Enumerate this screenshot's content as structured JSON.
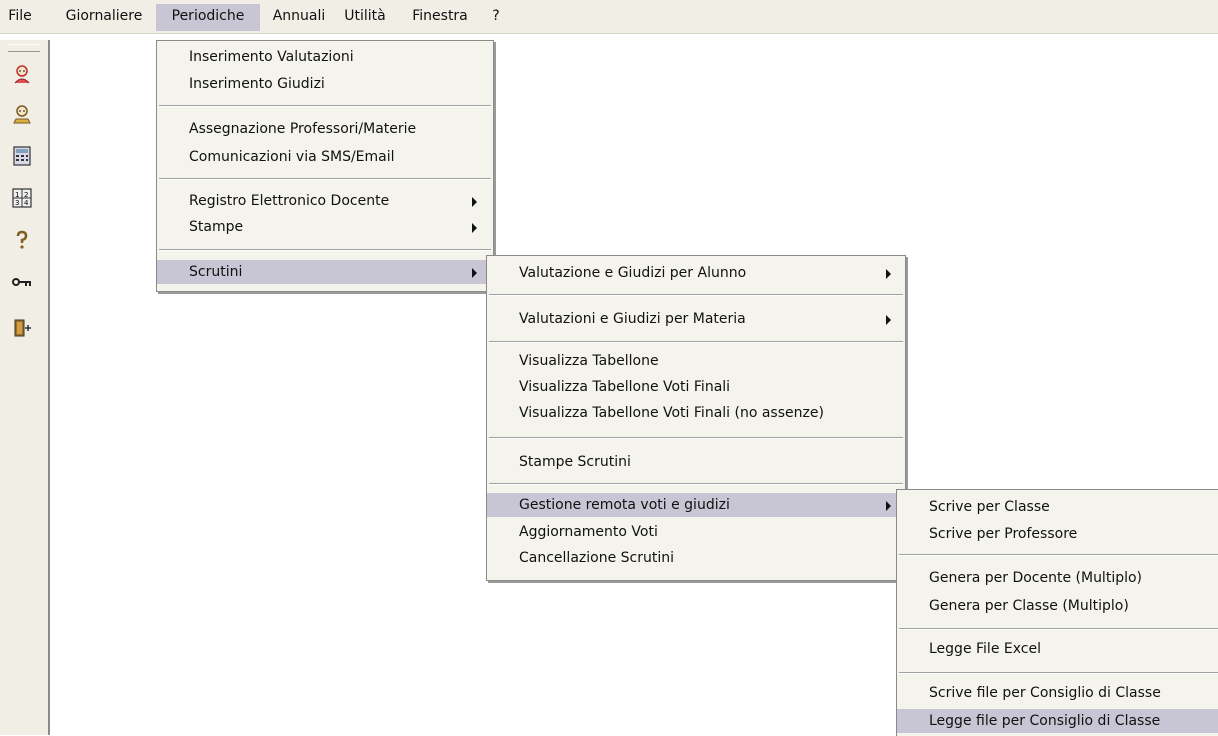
{
  "menubar": {
    "items": [
      "File",
      "Giornaliere",
      "Periodiche",
      "Annuali",
      "Utilità",
      "Finestra",
      "?"
    ],
    "active": "Periodiche"
  },
  "toolbar": {
    "icons": [
      "person-red-icon",
      "person-icon",
      "calculator-icon",
      "grid-numbers-icon",
      "help-icon",
      "key-icon",
      "exit-door-icon"
    ]
  },
  "menu_periodiche": {
    "items": [
      "Inserimento Valutazioni",
      "Inserimento Giudizi",
      "Assegnazione Professori/Materie",
      "Comunicazioni via SMS/Email",
      "Registro Elettronico Docente",
      "Stampe",
      "Scrutini"
    ],
    "highlighted": "Scrutini"
  },
  "menu_scrutini": {
    "items": [
      "Valutazione e Giudizi per Alunno",
      "Valutazioni e Giudizi per Materia",
      "Visualizza Tabellone",
      "Visualizza Tabellone Voti Finali",
      "Visualizza Tabellone Voti Finali (no assenze)",
      "Stampe Scrutini",
      "Gestione remota voti e giudizi",
      "Aggiornamento Voti",
      "Cancellazione Scrutini"
    ],
    "highlighted": "Gestione remota voti e giudizi"
  },
  "menu_gestione": {
    "items": [
      "Scrive per Classe",
      "Scrive per Professore",
      "Genera per Docente (Multiplo)",
      "Genera per Classe (Multiplo)",
      "Legge File Excel",
      "Scrive file per Consiglio di Classe",
      "Legge file per Consiglio di Classe"
    ],
    "highlighted": "Legge file per Consiglio di Classe"
  },
  "colors": {
    "menu_background": "#f4f3ec",
    "highlight": "#c8c6d4",
    "menubar_background": "#f0eee5"
  }
}
